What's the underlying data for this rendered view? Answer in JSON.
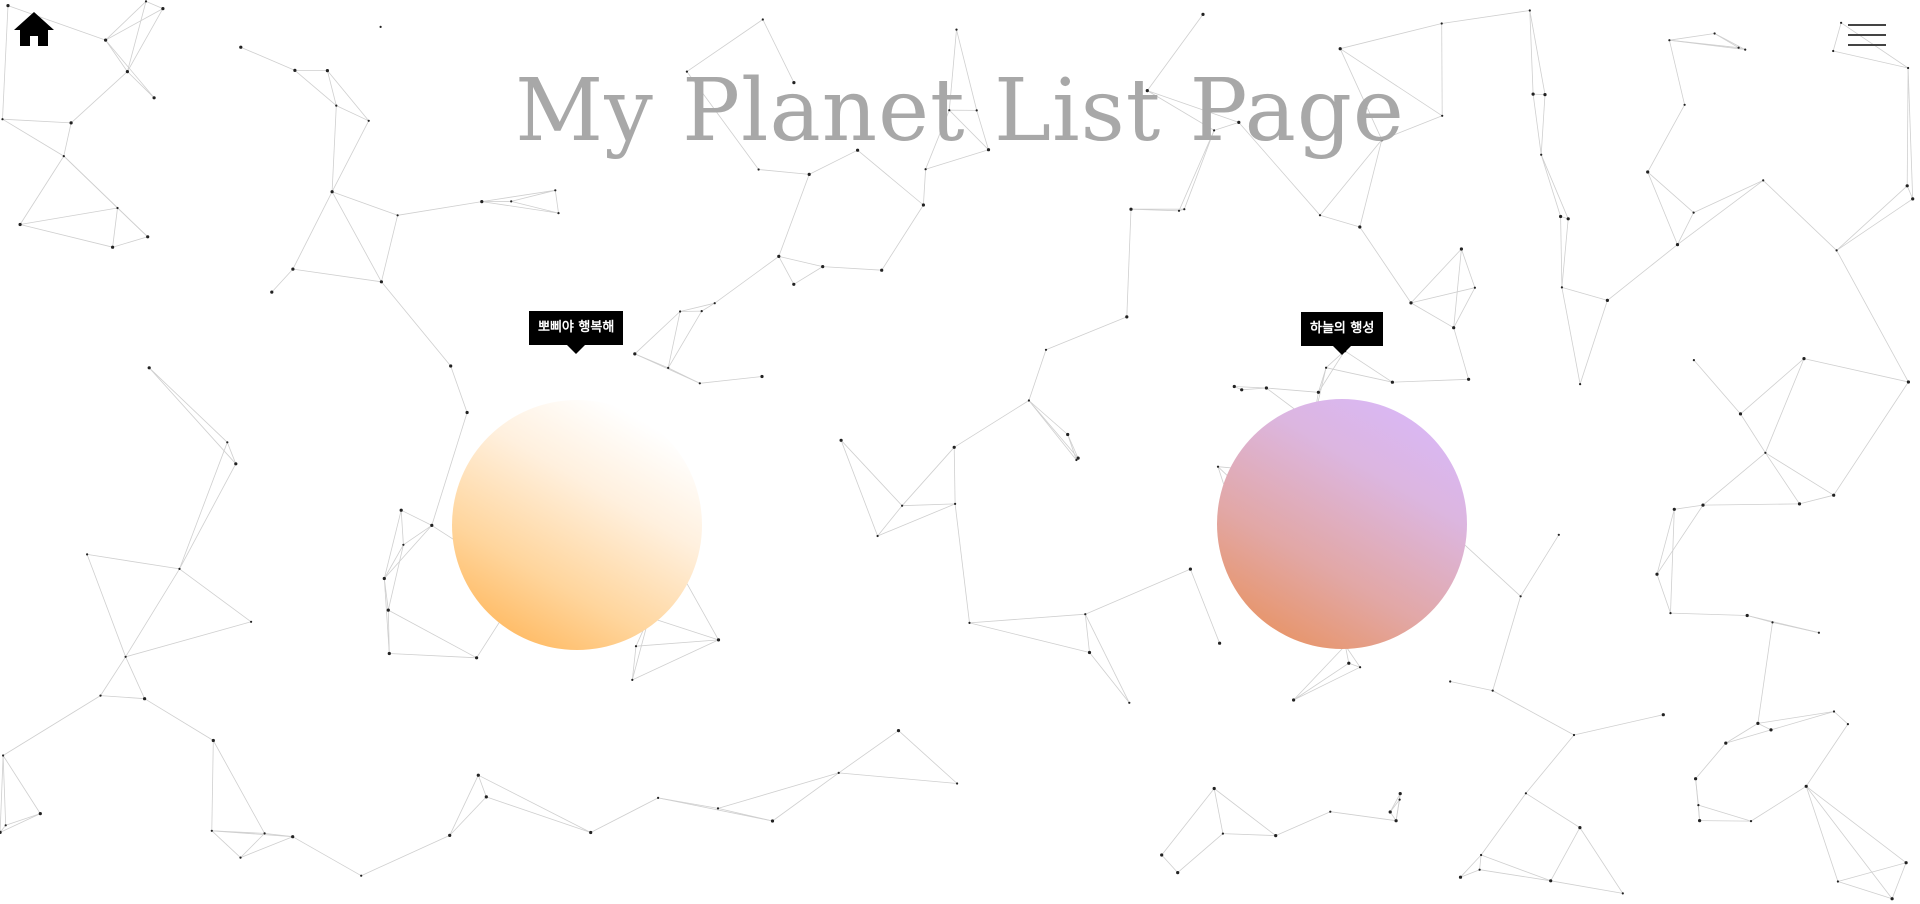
{
  "header": {
    "home_icon": "home-icon",
    "menu_icon": "hamburger-menu-icon",
    "title": "My Planet List Page"
  },
  "planets": [
    {
      "tooltip": "뽀삐야 행복해",
      "colors": [
        "#ffad47",
        "#ffd59c",
        "#fff0de",
        "#ffffff"
      ]
    },
    {
      "tooltip": "하늘의 행성",
      "colors": [
        "#ea8d4f",
        "#e2a7a5",
        "#dcb6e0",
        "#d8b8ff"
      ]
    }
  ],
  "colors": {
    "background": "#ffffff",
    "title": "#a8a8a8",
    "tooltip_bg": "#000000",
    "network_line": "#cfcfcf",
    "network_dot": "#222222"
  }
}
